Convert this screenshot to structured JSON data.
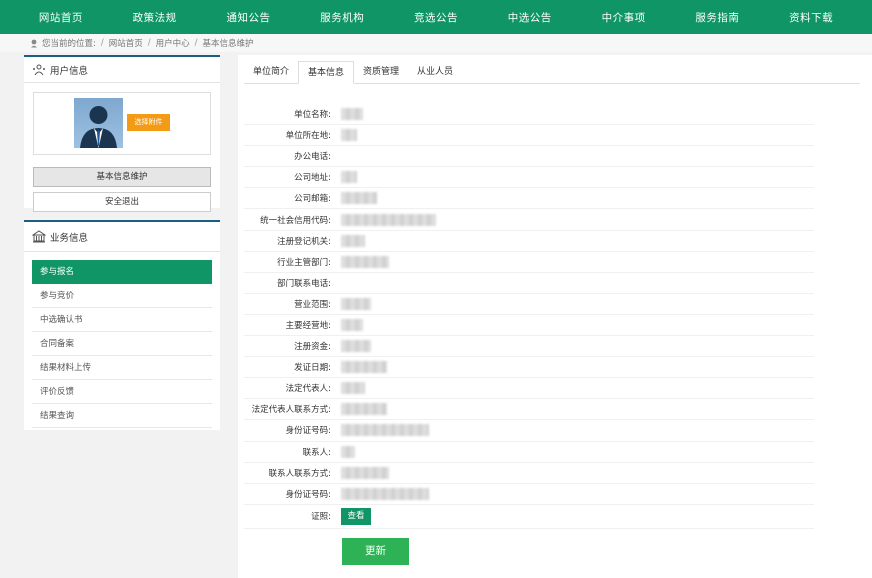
{
  "nav": [
    "网站首页",
    "政策法规",
    "通知公告",
    "服务机构",
    "竞选公告",
    "中选公告",
    "中介事项",
    "服务指南",
    "资料下载"
  ],
  "breadcrumb": {
    "prefix": "您当前的位置:",
    "items": [
      "网站首页",
      "用户中心",
      "基本信息维护"
    ]
  },
  "user_panel": {
    "title": "用户信息",
    "upload_label": "选择附件",
    "buttons": [
      "基本信息维护",
      "安全退出"
    ]
  },
  "biz_panel": {
    "title": "业务信息",
    "items": [
      "参与报名",
      "参与竞价",
      "中选确认书",
      "合同备案",
      "结果材料上传",
      "评价反馈",
      "结果查询"
    ]
  },
  "tabs": [
    "单位简介",
    "基本信息",
    "资质管理",
    "从业人员"
  ],
  "form_fields": [
    "单位名称:",
    "单位所在地:",
    "办公电话:",
    "公司地址:",
    "公司邮箱:",
    "统一社会信用代码:",
    "注册登记机关:",
    "行业主管部门:",
    "部门联系电话:",
    "营业范围:",
    "主要经营地:",
    "注册资金:",
    "发证日期:",
    "法定代表人:",
    "法定代表人联系方式:",
    "身份证号码:",
    "联系人:",
    "联系人联系方式:",
    "身份证号码:"
  ],
  "cert_label": "证照:",
  "view_label": "查看",
  "update_label": "更新",
  "colors": {
    "nav": "#0f9566",
    "accent_orange": "#f39a16",
    "update": "#2db255"
  }
}
